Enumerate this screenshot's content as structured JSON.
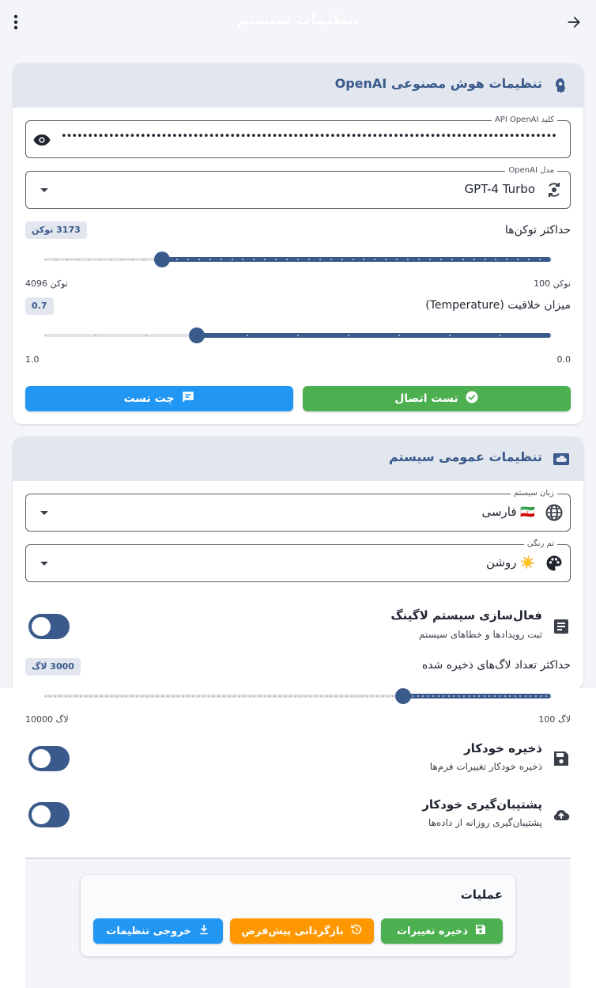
{
  "header": {
    "title": "تنظیمات سیستم",
    "menu_icon": "more-vert-icon",
    "back_icon": "arrow-forward-icon"
  },
  "openai": {
    "title": "تنظیمات هوش مصنوعی OpenAI",
    "icon": "ai-brain-icon",
    "api_key": {
      "label": "کلید API OpenAI",
      "value": "••••••••••••••••••••••••••••••••••••••••••••••••••••••••••••••••••••••••••••••••••••••••••••••••••••"
    },
    "model": {
      "label": "مدل OpenAI",
      "value": "GPT-4 Turbo"
    },
    "max_tokens": {
      "label": "حداکثر توکن‌ها",
      "badge": "3173 توکن",
      "min_label": "100 توکن",
      "max_label": "4096 توکن",
      "value": 3173,
      "min": 100,
      "max": 4096
    },
    "temperature": {
      "label": "میزان خلاقیت (Temperature)",
      "badge": "0.7",
      "min_label": "0.0",
      "max_label": "1.0",
      "value": 0.7,
      "min": 0,
      "max": 1
    },
    "test_connection_label": "تست اتصال",
    "test_chat_label": "چت تست"
  },
  "general": {
    "title": "تنظیمات عمومی سیستم",
    "icon": "cloud-icon",
    "language": {
      "label": "زبان سیستم",
      "value": "فارسی",
      "flag": "🇮🇷"
    },
    "theme": {
      "label": "تم رنگی",
      "value": "روشن",
      "emoji": "☀️"
    },
    "logging": {
      "title": "فعال‌سازی سیستم لاگینگ",
      "subtitle": "ثبت رویدادها و خطاهای سیستم",
      "on": false
    },
    "max_logs": {
      "label": "حداکثر تعداد لاگ‌های ذخیره شده",
      "badge": "3000 لاگ",
      "min_label": "100 لاگ",
      "max_label": "10000 لاگ",
      "value": 3000,
      "min": 100,
      "max": 10000
    },
    "autosave": {
      "title": "ذخیره خودکار",
      "subtitle": "ذخیره خودکار تغییرات فرم‌ها",
      "on": false
    },
    "autobackup": {
      "title": "پشتیبان‌گیری خودکار",
      "subtitle": "پشتیبان‌گیری روزانه از داده‌ها",
      "on": false
    }
  },
  "actions": {
    "title": "عملیات",
    "save_label": "ذخیره تغییرات",
    "reset_label": "بازگردانی پیش‌فرض",
    "export_label": "خروجی تنظیمات"
  },
  "colors": {
    "primary": "#3a5a8c",
    "green": "#4caf50",
    "blue": "#2196f3",
    "orange": "#ff9800"
  }
}
